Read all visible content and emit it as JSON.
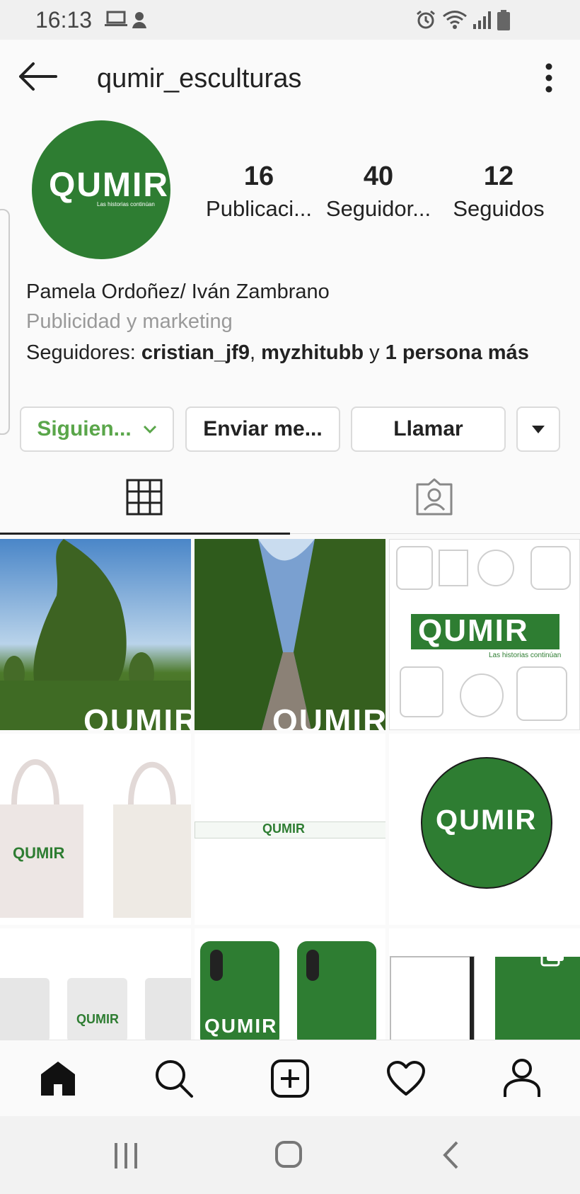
{
  "status_bar": {
    "time": "16:13"
  },
  "header": {
    "username": "qumir_esculturas"
  },
  "profile": {
    "stats": [
      {
        "value": "16",
        "label": "Publicaci..."
      },
      {
        "value": "40",
        "label": "Seguidor..."
      },
      {
        "value": "12",
        "label": "Seguidos"
      }
    ],
    "name": "Pamela Ordoñez/ Iván Zambrano",
    "category": "Publicidad y marketing",
    "followers_prefix": "Seguidores: ",
    "follower1": "cristian_jf9",
    "sep": ", ",
    "follower2": "myzhitubb",
    "and": " y ",
    "others": "1 persona más"
  },
  "buttons": {
    "following": "Siguien...",
    "message": "Enviar me...",
    "call": "Llamar"
  },
  "logo": {
    "text": "QUMIR",
    "tagline": "Las historias continúan"
  },
  "colors": {
    "brand_green": "#2e7d32",
    "following_green": "#5aa64a"
  }
}
